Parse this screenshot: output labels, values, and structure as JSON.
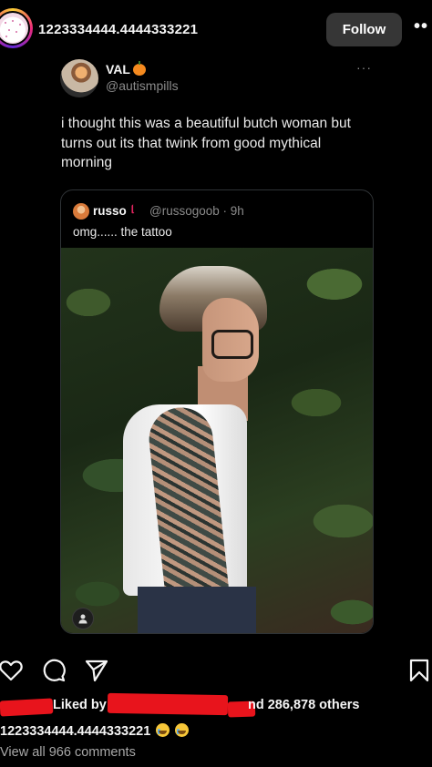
{
  "header": {
    "username": "1223334444.4444333221",
    "follow_label": "Follow",
    "more_label": "••"
  },
  "tweet": {
    "name": "VAL",
    "handle": "@autismpills",
    "more_label": "···",
    "text": "i thought this was a beautiful butch woman but turns out its that twink from good mythical morning",
    "quote": {
      "name": "russo",
      "emoji": "୲",
      "handle_time": "@russogoob · 9h",
      "text": "omg...... the tattoo"
    }
  },
  "actions": {
    "like_icon": "heart-icon",
    "comment_icon": "comment-icon",
    "share_icon": "send-icon",
    "save_icon": "bookmark-icon"
  },
  "likes": {
    "prefix": "Liked by",
    "suffix": "nd 286,878 others"
  },
  "caption": {
    "username": "1223334444.4444333221"
  },
  "comments": {
    "label": "View all 966 comments"
  },
  "colors": {
    "background": "#000000",
    "follow_button": "#363636",
    "redaction": "#e8141c",
    "muted_text": "#8b8b8b"
  }
}
